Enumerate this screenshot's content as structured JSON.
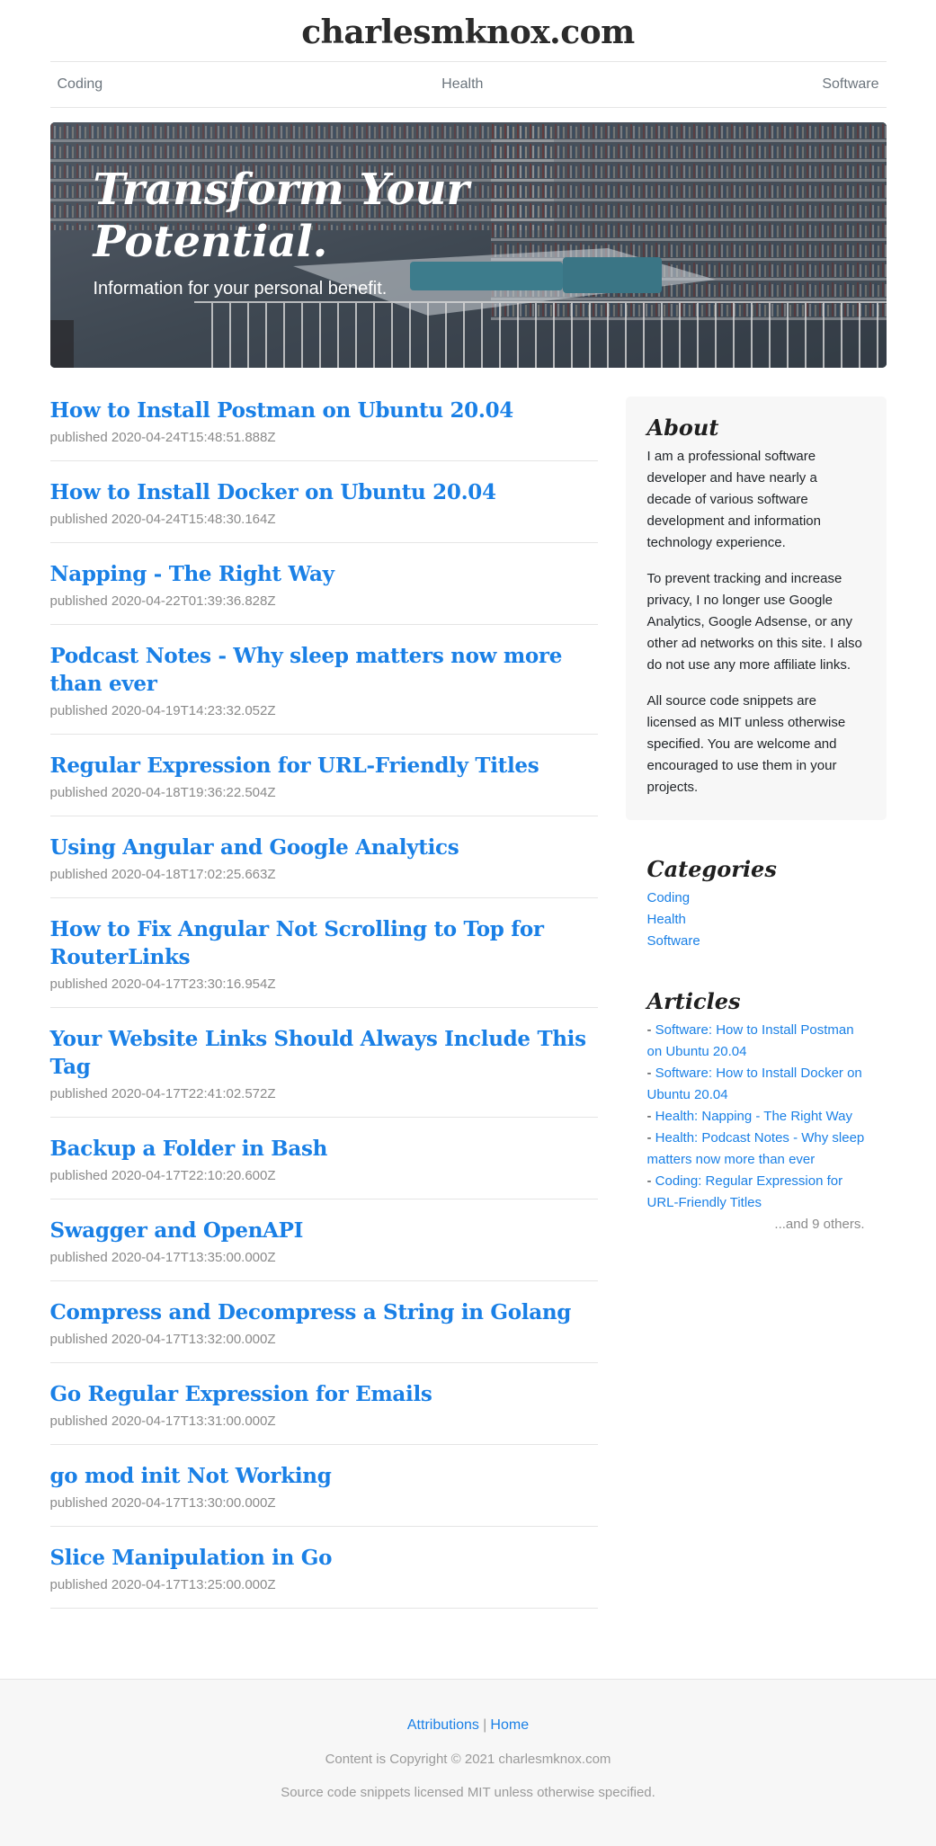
{
  "site": {
    "title": "charlesmknox.com"
  },
  "nav": {
    "items": [
      "Coding",
      "Health",
      "Software"
    ]
  },
  "hero": {
    "title": "Transform Your Potential.",
    "lead": "Information for your personal benefit."
  },
  "posts": [
    {
      "title": "How to Install Postman on Ubuntu 20.04",
      "meta": "published 2020-04-24T15:48:51.888Z"
    },
    {
      "title": "How to Install Docker on Ubuntu 20.04",
      "meta": "published 2020-04-24T15:48:30.164Z"
    },
    {
      "title": "Napping - The Right Way",
      "meta": "published 2020-04-22T01:39:36.828Z"
    },
    {
      "title": "Podcast Notes - Why sleep matters now more than ever",
      "meta": "published 2020-04-19T14:23:32.052Z"
    },
    {
      "title": "Regular Expression for URL-Friendly Titles",
      "meta": "published 2020-04-18T19:36:22.504Z"
    },
    {
      "title": "Using Angular and Google Analytics",
      "meta": "published 2020-04-18T17:02:25.663Z"
    },
    {
      "title": "How to Fix Angular Not Scrolling to Top for RouterLinks",
      "meta": "published 2020-04-17T23:30:16.954Z"
    },
    {
      "title": "Your Website Links Should Always Include This Tag",
      "meta": "published 2020-04-17T22:41:02.572Z"
    },
    {
      "title": "Backup a Folder in Bash",
      "meta": "published 2020-04-17T22:10:20.600Z"
    },
    {
      "title": "Swagger and OpenAPI",
      "meta": "published 2020-04-17T13:35:00.000Z"
    },
    {
      "title": "Compress and Decompress a String in Golang",
      "meta": "published 2020-04-17T13:32:00.000Z"
    },
    {
      "title": "Go Regular Expression for Emails",
      "meta": "published 2020-04-17T13:31:00.000Z"
    },
    {
      "title": "go mod init Not Working",
      "meta": "published 2020-04-17T13:30:00.000Z"
    },
    {
      "title": "Slice Manipulation in Go",
      "meta": "published 2020-04-17T13:25:00.000Z"
    }
  ],
  "about": {
    "heading": "About",
    "paragraphs": [
      "I am a professional software developer and have nearly a decade of various software development and information technology experience.",
      "To prevent tracking and increase privacy, I no longer use Google Analytics, Google Adsense, or any other ad networks on this site. I also do not use any more affiliate links.",
      "All source code snippets are licensed as MIT unless otherwise specified. You are welcome and encouraged to use them in your projects."
    ]
  },
  "categories": {
    "heading": "Categories",
    "items": [
      "Coding",
      "Health",
      "Software"
    ]
  },
  "articles": {
    "heading": "Articles",
    "prefix": "- ",
    "items": [
      "Software: How to Install Postman on Ubuntu 20.04",
      "Software: How to Install Docker on Ubuntu 20.04",
      "Health: Napping - The Right Way",
      "Health: Podcast Notes - Why sleep matters now more than ever",
      "Coding: Regular Expression for URL-Friendly Titles"
    ],
    "more": "...and 9 others."
  },
  "footer": {
    "attributions": "Attributions",
    "separator": "|",
    "home": "Home",
    "copyright": "Content is Copyright © 2021 charlesmknox.com",
    "license": "Source code snippets licensed MIT unless otherwise specified."
  },
  "colors": {
    "link": "#1a80e6",
    "muted": "#8a8a8a",
    "panel": "#f7f7f7"
  }
}
